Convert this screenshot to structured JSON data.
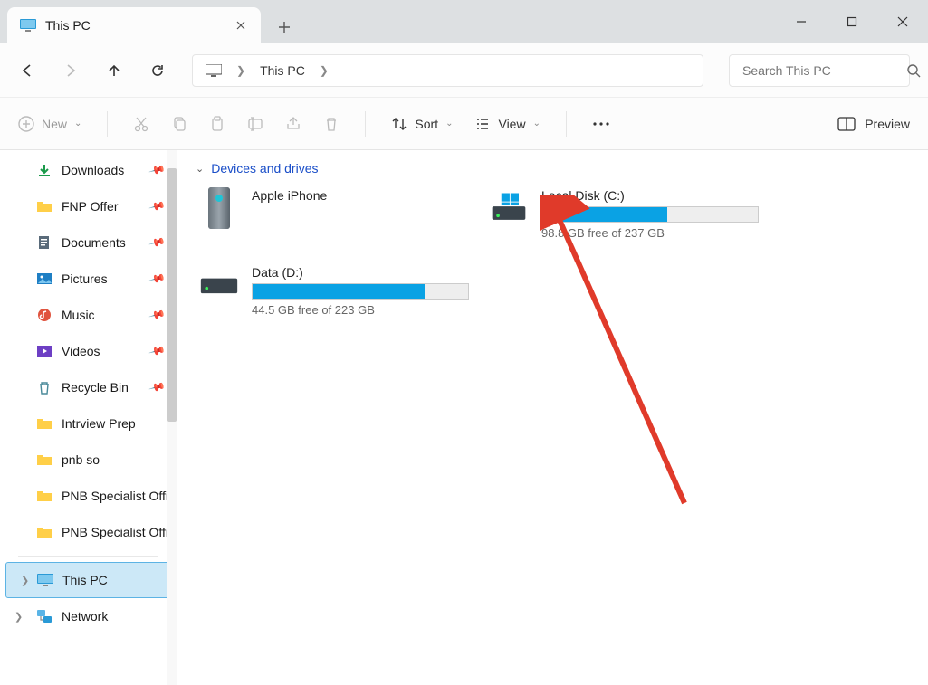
{
  "window": {
    "tab_title": "This PC",
    "search_placeholder": "Search This PC"
  },
  "address": {
    "segments": [
      "This PC"
    ]
  },
  "toolbar": {
    "new_label": "New",
    "sort_label": "Sort",
    "view_label": "View",
    "preview_label": "Preview"
  },
  "sidebar": {
    "items_pinned": [
      {
        "label": "Downloads",
        "icon": "downloads",
        "pinned": true
      },
      {
        "label": "FNP Offer",
        "icon": "folder",
        "pinned": true
      },
      {
        "label": "Documents",
        "icon": "documents",
        "pinned": true
      },
      {
        "label": "Pictures",
        "icon": "pictures",
        "pinned": true
      },
      {
        "label": "Music",
        "icon": "music",
        "pinned": true
      },
      {
        "label": "Videos",
        "icon": "videos",
        "pinned": true
      },
      {
        "label": "Recycle Bin",
        "icon": "recycle",
        "pinned": true
      },
      {
        "label": "Intrview Prep",
        "icon": "folder",
        "pinned": false
      },
      {
        "label": "pnb so",
        "icon": "folder",
        "pinned": false
      },
      {
        "label": "PNB Specialist Officer",
        "icon": "folder",
        "pinned": false
      },
      {
        "label": "PNB Specialist Officer",
        "icon": "folder",
        "pinned": false
      }
    ],
    "this_pc": "This PC",
    "network": "Network"
  },
  "content": {
    "section_label": "Devices and drives",
    "drives": [
      {
        "label": "Apple iPhone",
        "type": "device",
        "free": "",
        "total": "",
        "fill_pct": 0
      },
      {
        "label": "Local Disk (C:)",
        "type": "os-drive",
        "free": "98.8 GB free of 237 GB",
        "fill_pct": 58
      },
      {
        "label": "Data (D:)",
        "type": "drive",
        "free": "44.5 GB free of 223 GB",
        "fill_pct": 80
      }
    ]
  }
}
